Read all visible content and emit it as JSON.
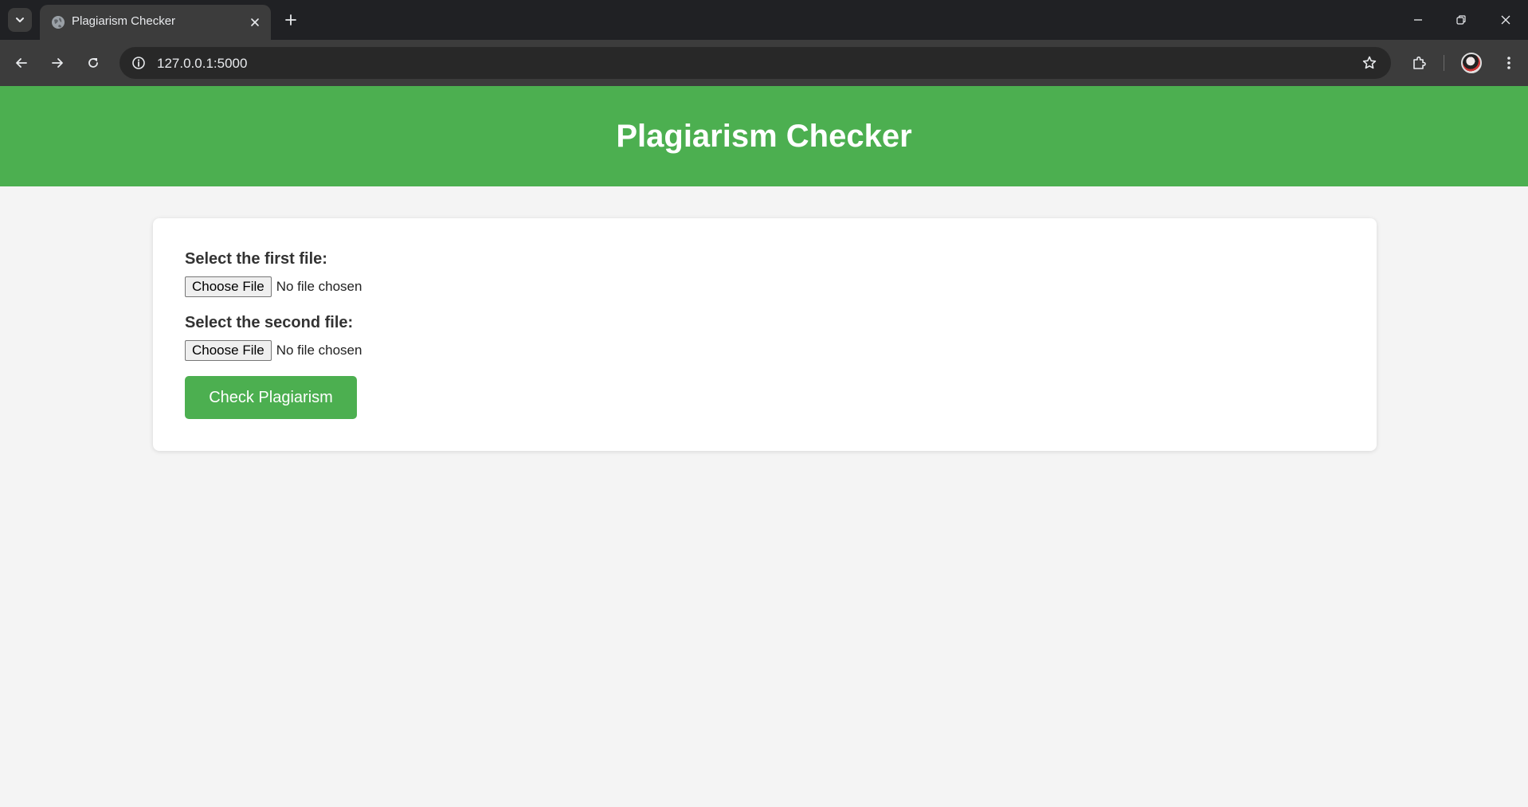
{
  "browser": {
    "tab_title": "Plagiarism Checker",
    "url": "127.0.0.1:5000",
    "icons": {
      "tab_search": "chevron-down-icon",
      "favicon": "globe-icon",
      "tab_close": "close-icon",
      "new_tab": "plus-icon",
      "back": "arrow-left-icon",
      "forward": "arrow-right-icon",
      "reload": "reload-icon",
      "site_info": "info-icon",
      "bookmark": "star-icon",
      "extensions": "puzzle-icon",
      "profile": "avatar",
      "menu": "kebab-menu-icon",
      "minimize": "minimize-icon",
      "restore": "restore-icon",
      "close_window": "close-icon"
    }
  },
  "header": {
    "title": "Plagiarism Checker",
    "background_color": "#4caf50"
  },
  "form": {
    "first_file": {
      "label": "Select the first file:",
      "button_label": "Choose File",
      "status": "No file chosen"
    },
    "second_file": {
      "label": "Select the second file:",
      "button_label": "Choose File",
      "status": "No file chosen"
    },
    "submit_label": "Check Plagiarism",
    "accent_color": "#4caf50"
  }
}
